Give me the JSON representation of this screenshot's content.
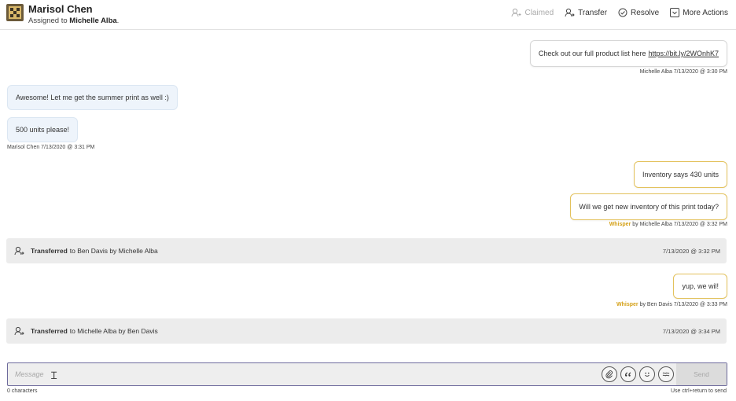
{
  "header": {
    "contact_name": "Marisol Chen",
    "assigned_prefix": "Assigned to",
    "assigned_agent": "Michelle Alba",
    "assigned_suffix": ".",
    "actions": {
      "claimed": "Claimed",
      "transfer": "Transfer",
      "resolve": "Resolve",
      "more": "More Actions"
    }
  },
  "messages": [
    {
      "text": "Check out our full product list here",
      "link": "https://bit.ly/2WOnhK7",
      "meta": "Michelle Alba 7/13/2020 @ 3:30 PM"
    },
    {
      "text": "Awesome! Let me get the summer print as well :)"
    },
    {
      "text": "500 units please!",
      "meta": "Marisol Chen 7/13/2020 @ 3:31 PM"
    },
    {
      "text": "Inventory says 430 units"
    },
    {
      "text": "Will we get new inventory of this print today?",
      "whisper": "Whisper",
      "meta": "by Michelle Alba 7/13/2020 @ 3:32 PM"
    },
    {
      "text": "yup, we wil!",
      "whisper": "Whisper",
      "meta": "by Ben Davis 7/13/2020 @ 3:33 PM"
    }
  ],
  "transfers": [
    {
      "label": "Transferred",
      "detail": "to Ben Davis by Michelle Alba",
      "time": "7/13/2020 @ 3:32 PM"
    },
    {
      "label": "Transferred",
      "detail": "to Michelle Alba by Ben Davis",
      "time": "7/13/2020 @ 3:34 PM"
    }
  ],
  "composer": {
    "placeholder": "Message",
    "char_count": "0 characters",
    "send_label": "Send",
    "hint": "Use ctrl+return to send",
    "tools": [
      "paperclip-icon",
      "quote-icon",
      "emoji-icon",
      "wave-icon"
    ]
  },
  "colors": {
    "whisper_border": "#e3c25d",
    "whisper_label": "#d4a017",
    "customer_bubble": "#eef4fb",
    "composer_border": "#6d6a9c"
  }
}
